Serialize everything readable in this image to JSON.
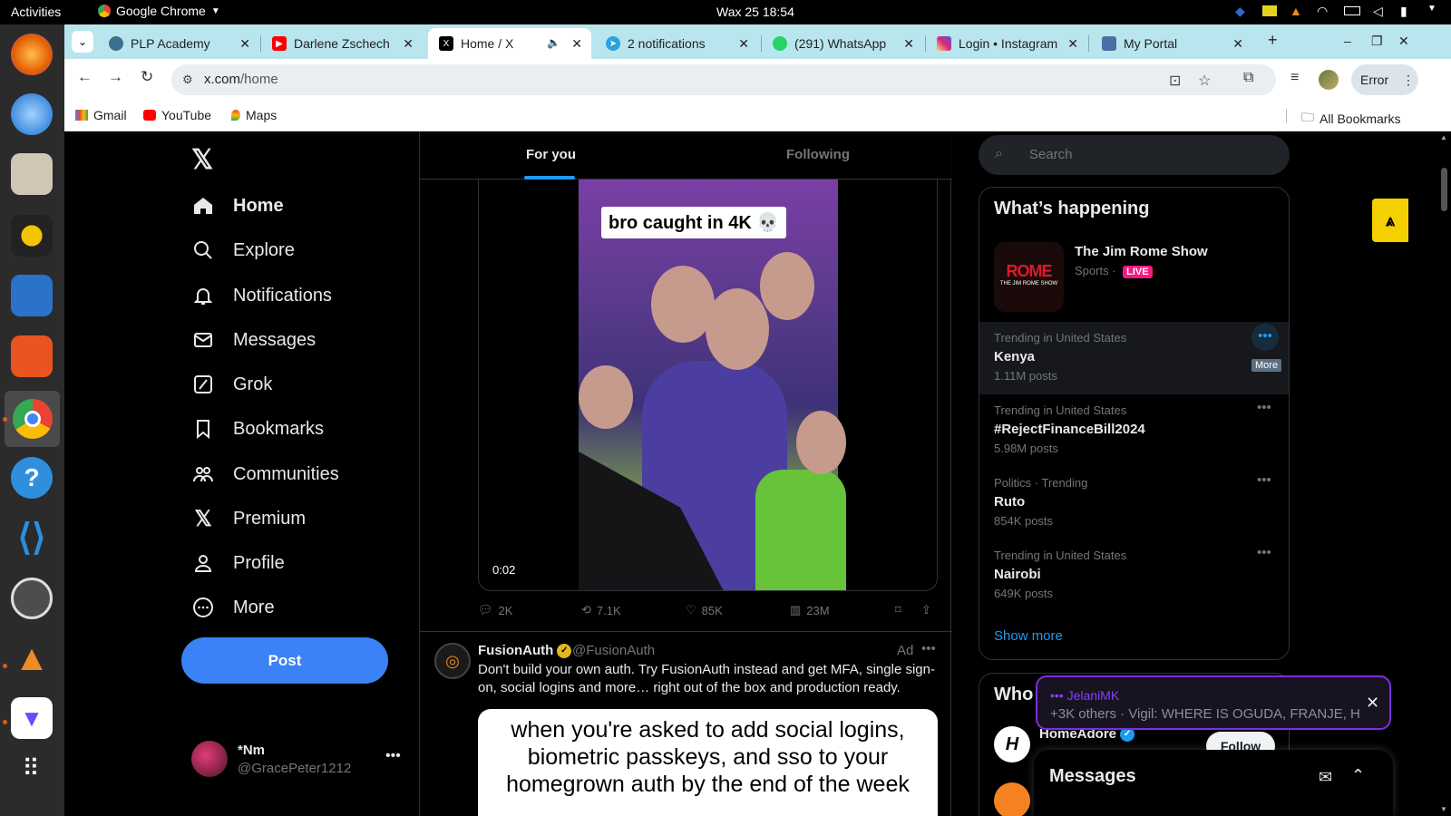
{
  "system": {
    "activities": "Activities",
    "app_name": "Google Chrome",
    "clock": "Wax 25  18:54"
  },
  "browser": {
    "tabs": [
      {
        "title": "PLP Academy",
        "icon": "plp-icon",
        "color": "#3d6f8e"
      },
      {
        "title": "Darlene Zschech",
        "icon": "youtube-icon",
        "color": "#ff0000"
      },
      {
        "title": "Home / X",
        "icon": "x-icon",
        "color": "#000000",
        "active": true
      },
      {
        "title": "2 notifications",
        "icon": "telegram-icon",
        "color": "#2aa3de"
      },
      {
        "title": "(291) WhatsApp",
        "icon": "whatsapp-icon",
        "color": "#25d366"
      },
      {
        "title": "Login • Instagram",
        "icon": "instagram-icon",
        "color": "#d62976"
      },
      {
        "title": "My Portal",
        "icon": "portal-icon",
        "color": "#4a6fa5"
      }
    ],
    "url_host": "x.com",
    "url_path": "/home",
    "error_label": "Error",
    "bookmarks": [
      {
        "label": "Gmail",
        "icon": "gmail-icon"
      },
      {
        "label": "YouTube",
        "icon": "youtube-icon"
      },
      {
        "label": "Maps",
        "icon": "maps-icon"
      }
    ],
    "all_bookmarks": "All Bookmarks"
  },
  "x": {
    "nav": [
      {
        "label": "Home",
        "icon": "home-icon"
      },
      {
        "label": "Explore",
        "icon": "search-icon"
      },
      {
        "label": "Notifications",
        "icon": "bell-icon"
      },
      {
        "label": "Messages",
        "icon": "mail-icon"
      },
      {
        "label": "Grok",
        "icon": "grok-icon"
      },
      {
        "label": "Bookmarks",
        "icon": "bookmark-icon"
      },
      {
        "label": "Communities",
        "icon": "communities-icon"
      },
      {
        "label": "Premium",
        "icon": "x-premium-icon"
      },
      {
        "label": "Profile",
        "icon": "profile-icon"
      },
      {
        "label": "More",
        "icon": "more-circle-icon"
      }
    ],
    "post_label": "Post",
    "account": {
      "name": "*Nm",
      "handle": "@GracePeter1212"
    },
    "feed_tabs": [
      "For you",
      "Following"
    ],
    "video": {
      "caption": "bro caught in 4K 💀",
      "time": "0:02"
    },
    "tweet_stats": {
      "replies": "2K",
      "reposts": "7.1K",
      "likes": "85K",
      "views": "23M"
    },
    "ad": {
      "name": "FusionAuth",
      "handle": "@FusionAuth",
      "tag": "Ad",
      "text": "Don't build your own auth. Try FusionAuth instead and get MFA, single sign-on, social logins and more… right out of the box and production ready.",
      "meme": "when you're asked to add social logins, biometric passkeys, and sso to your homegrown auth by the end of the week"
    },
    "search_placeholder": "Search",
    "happening": {
      "title": "What’s happening",
      "featured": {
        "title": "The Jim Rome Show",
        "category": "Sports · ",
        "live": "LIVE",
        "logo": "ROME",
        "logo_sub": "THE JIM ROME SHOW"
      },
      "trends": [
        {
          "context": "Trending in United States",
          "topic": "Kenya",
          "count": "1.11M posts"
        },
        {
          "context": "Trending in United States",
          "topic": "#RejectFinanceBill2024",
          "count": "5.98M posts"
        },
        {
          "context": "Politics · Trending",
          "topic": "Ruto",
          "count": "854K posts"
        },
        {
          "context": "Trending in United States",
          "topic": "Nairobi",
          "count": "649K posts"
        }
      ],
      "more_tooltip": "More",
      "show_more": "Show more"
    },
    "who_to_follow": {
      "title": "Who",
      "account": "HomeAdore",
      "follow": "Follow"
    },
    "notification_popup": {
      "user": "JelaniMK",
      "text": "+3K others · Vigil: WHERE IS OGUDA, FRANJE, H"
    },
    "messages_drawer": "Messages"
  }
}
